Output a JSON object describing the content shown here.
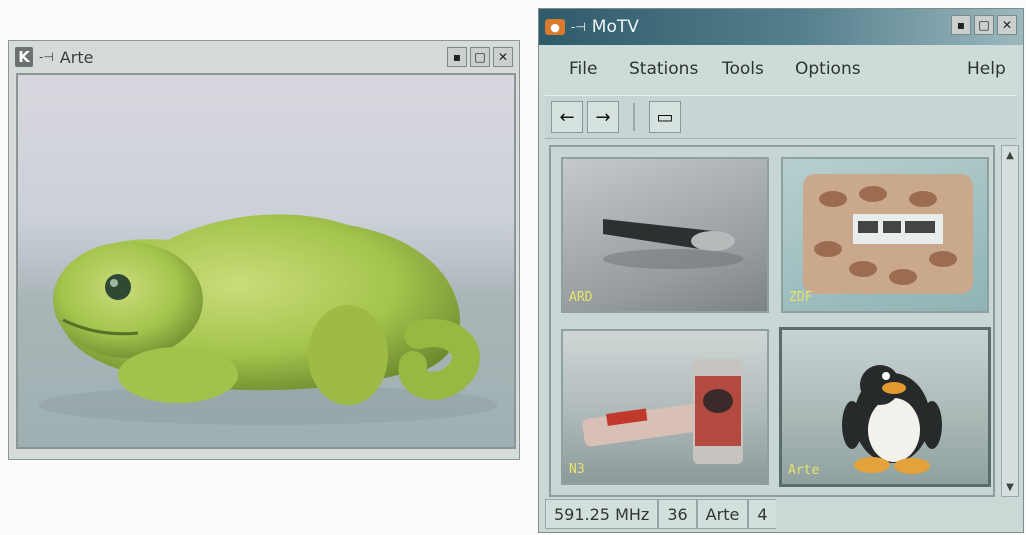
{
  "arte_window": {
    "title": "Arte",
    "controls": [
      "minimize-icon",
      "maximize-icon",
      "close-icon"
    ]
  },
  "motv_window": {
    "title": "MoTV",
    "menu": {
      "file": "File",
      "stations": "Stations",
      "tools": "Tools",
      "options": "Options",
      "help": "Help"
    },
    "toolbar": [
      "back-arrow-icon",
      "forward-arrow-icon",
      "fullscreen-icon"
    ],
    "stations": [
      {
        "label": "ARD"
      },
      {
        "label": "ZDF"
      },
      {
        "label": "N3"
      },
      {
        "label": "Arte"
      }
    ],
    "status": {
      "frequency": "591.25 MHz",
      "channel": "36",
      "station": "Arte",
      "index": "4"
    }
  },
  "colors": {
    "label_yellow": "#e7e36a",
    "title_gradient_start": "#2f5a6a",
    "window_bg": "#cad8d6"
  }
}
